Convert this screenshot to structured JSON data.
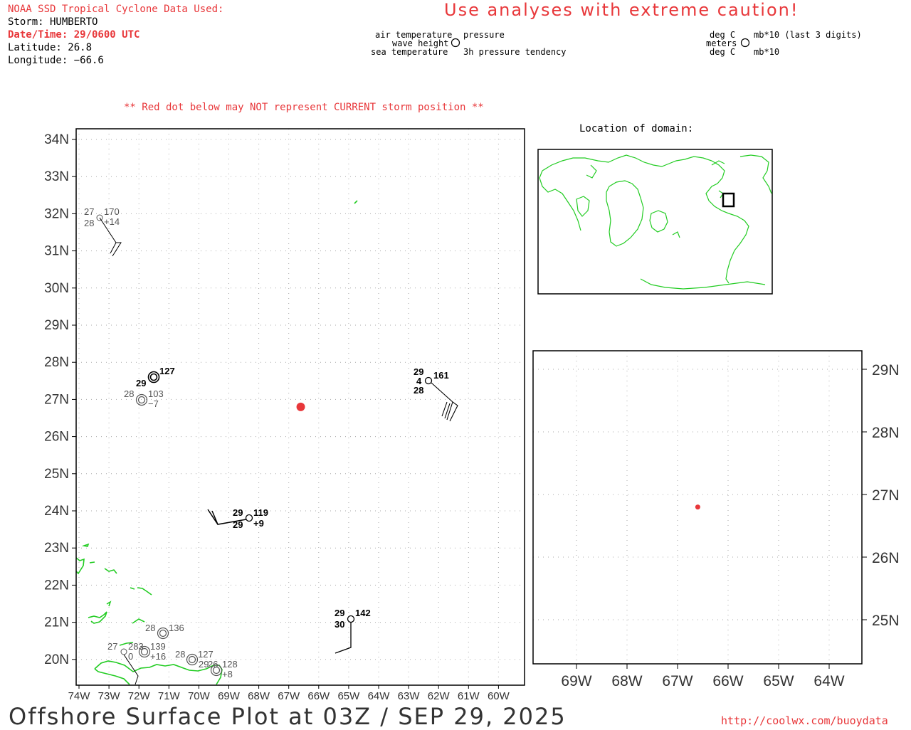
{
  "header": {
    "source_title": "NOAA SSD Tropical Cyclone Data Used:",
    "storm": "Storm: HUMBERTO",
    "datetime": "Date/Time: 29/0600 UTC",
    "latitude": "Latitude: 26.8",
    "longitude": "Longitude: −66.6",
    "caution": "Use analyses with extreme caution!"
  },
  "legend_left": {
    "air_temperature": "air temperature",
    "pressure": "pressure",
    "wave_height": "wave height",
    "sea_temperature": "sea temperature",
    "pressure_tendency": "3h pressure tendency"
  },
  "legend_right": {
    "deg_c_top": "deg C",
    "mb_top": "mb*10 (last 3 digits)",
    "meters": "meters",
    "deg_c_bottom": "deg C",
    "mb_bottom": "mb*10"
  },
  "notes": {
    "red_dot": "** Red dot below may NOT represent CURRENT storm position **",
    "location_of_domain": "Location of domain:"
  },
  "footer": {
    "title": "Offshore Surface Plot at 03Z / SEP 29, 2025",
    "url": "http://coolwx.com/buoydata"
  },
  "map": {
    "lat_labels": [
      "34N",
      "33N",
      "32N",
      "31N",
      "30N",
      "29N",
      "28N",
      "27N",
      "26N",
      "25N",
      "24N",
      "23N",
      "22N",
      "21N",
      "20N"
    ],
    "lon_labels": [
      "74W",
      "73W",
      "72W",
      "71W",
      "70W",
      "69W",
      "68W",
      "67W",
      "66W",
      "65W",
      "64W",
      "63W",
      "62W",
      "61W",
      "60W"
    ],
    "storm_position": {
      "lat": 26.8,
      "lon": -66.6
    },
    "stations": [
      {
        "id": "st-a",
        "top": "27",
        "right": "170",
        "bottom": "28",
        "tendency": "+14"
      },
      {
        "id": "st-b",
        "top": "",
        "right": "127",
        "bottom": "29",
        "tendency": ""
      },
      {
        "id": "st-c",
        "top": "28",
        "right": "103",
        "bottom": "",
        "tendency": "−7"
      },
      {
        "id": "st-d",
        "top": "29",
        "right": "161",
        "mid": "4",
        "bottom": "28",
        "tendency": ""
      },
      {
        "id": "st-e",
        "top": "29",
        "right": "119",
        "bottom": "29",
        "tendency": "+9"
      },
      {
        "id": "st-f",
        "top": "29",
        "right": "142",
        "bottom": "30",
        "tendency": ""
      },
      {
        "id": "st-g",
        "top": "28",
        "right": "136",
        "bottom": "",
        "tendency": ""
      },
      {
        "id": "st-h",
        "top": "27",
        "right": "0",
        "bottom": "",
        "tendency": ""
      },
      {
        "id": "st-i",
        "top": "283",
        "right": "139",
        "bottom": "",
        "tendency": "+16"
      },
      {
        "id": "st-j",
        "top": "28",
        "right": "127",
        "bottom": "29",
        "tendency": ""
      },
      {
        "id": "st-k",
        "top": "26",
        "right": "128",
        "bottom": "",
        "tendency": "+8"
      }
    ]
  },
  "zoom": {
    "lat_labels": [
      "29N",
      "28N",
      "27N",
      "26N",
      "25N"
    ],
    "lon_labels": [
      "69W",
      "68W",
      "67W",
      "66W",
      "65W",
      "64W"
    ],
    "storm_position": {
      "lat": 26.8,
      "lon": -66.6
    }
  },
  "colors": {
    "storm_dot": "#e8373a",
    "coastline": "#22cc22",
    "grid": "#aaaaaa",
    "caution_text": "#e8373a"
  }
}
